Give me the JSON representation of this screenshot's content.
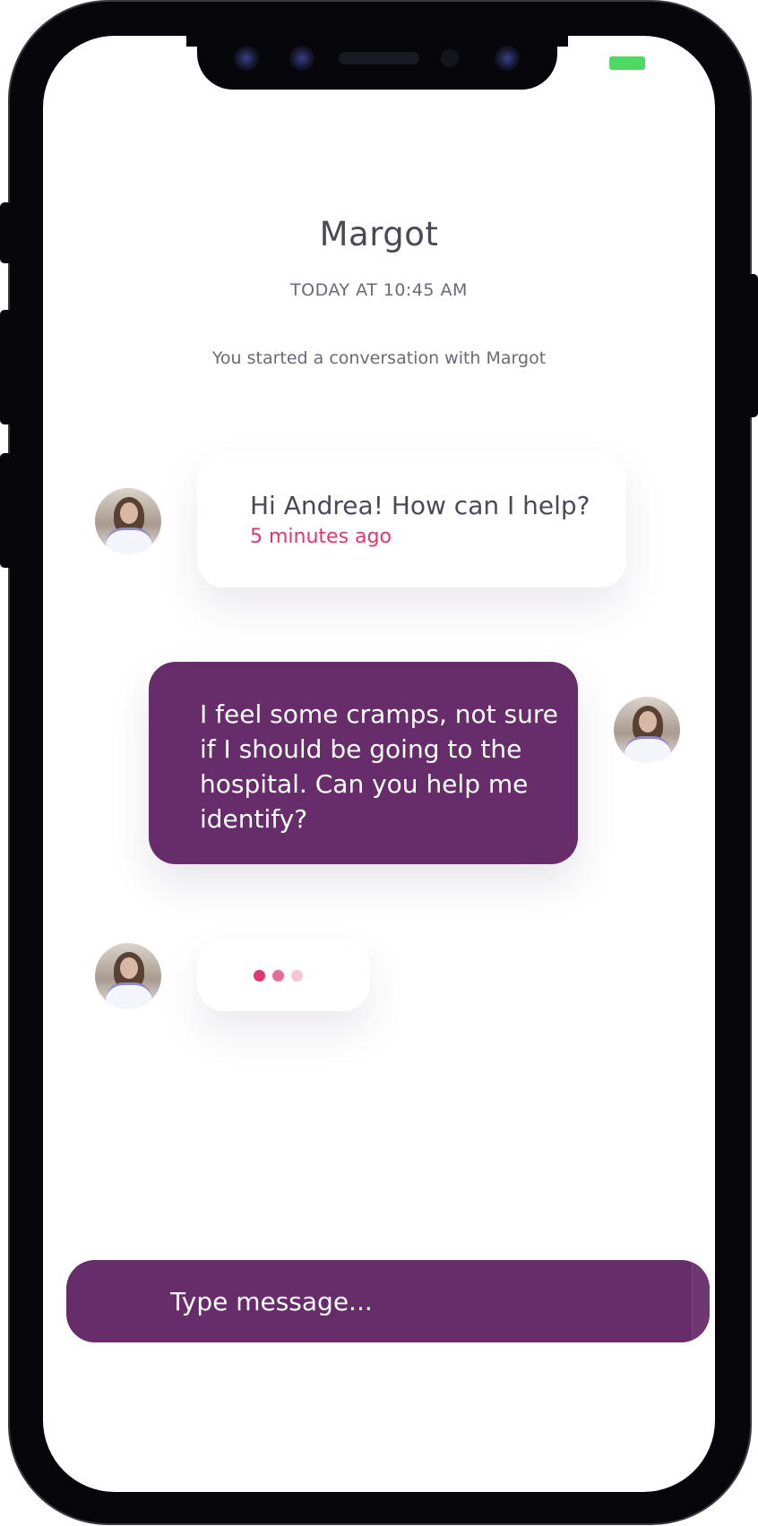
{
  "chat": {
    "contact_name": "Margot",
    "timestamp": "TODAY AT 10:45 AM",
    "start_notice": "You started a conversation with Margot"
  },
  "messages": [
    {
      "from": "contact",
      "text": "Hi Andrea! How can I help?",
      "time": "5 minutes ago"
    },
    {
      "from": "user",
      "text": "I feel some cramps, not sure if I should be going to the hospital. Can you help me identify?"
    }
  ],
  "typing_indicator": {
    "from": "contact",
    "dot_colors": [
      "#e3366d",
      "#e86b93",
      "#f5c5d5"
    ]
  },
  "composer": {
    "placeholder": "Type message..."
  },
  "colors": {
    "accent": "#662d6a",
    "time_pink": "#e3366d",
    "battery": "#4cd964"
  },
  "icons": {
    "status_battery": "battery-icon",
    "avatar": "avatar-photo"
  }
}
